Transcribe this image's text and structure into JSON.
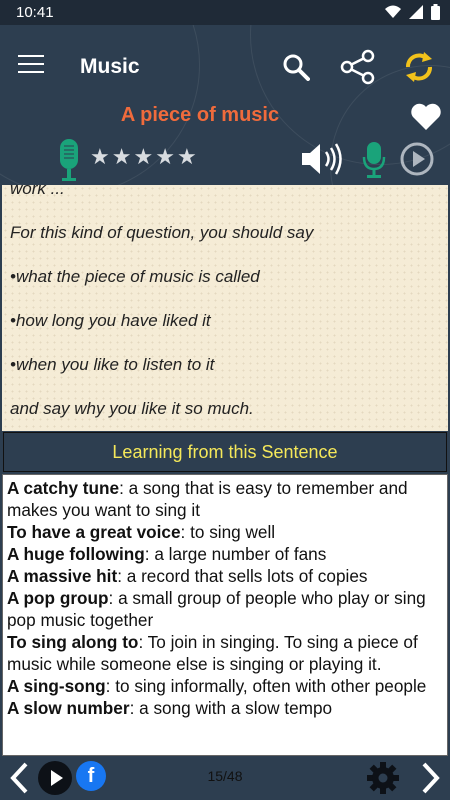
{
  "status_bar": {
    "time": "10:41"
  },
  "header": {
    "title": "Music",
    "subtitle": "A piece of music",
    "rating_stars": 5
  },
  "passage": {
    "lines": [
      "work ...",
      "For this kind of question, you should say",
      "•what the piece of music is called",
      "•how long you have liked it",
      "•when you like to listen to it",
      "and say why you like it so much."
    ]
  },
  "learning": {
    "title": "Learning from this Sentence",
    "items": [
      {
        "term": "A catchy tune",
        "definition": ": a song that is easy to remember and makes you want to sing it"
      },
      {
        "term": "To have a great voice",
        "definition": ": to sing well"
      },
      {
        "term": "A huge following",
        "definition": ": a large number of fans"
      },
      {
        "term": "A massive hit",
        "definition": ": a record that sells lots of copies"
      },
      {
        "term": "A pop group",
        "definition": ": a small group of people who play or sing pop music together"
      },
      {
        "term": "To sing along to",
        "definition": ": To join in singing. To sing a piece of music while someone else is singing or playing it."
      },
      {
        "term": "A sing-song",
        "definition": ": to sing informally, often with other people"
      },
      {
        "term": "A slow number",
        "definition": ": a song with a slow tempo"
      }
    ]
  },
  "bottom_bar": {
    "page": "15/48",
    "facebook_label": "f"
  },
  "colors": {
    "accent": "#f06b3c",
    "header_bg": "#2d3e50",
    "learn_title": "#f5e85a",
    "mic_green": "#1aa37a",
    "sync_yellow": "#f2c21b"
  }
}
